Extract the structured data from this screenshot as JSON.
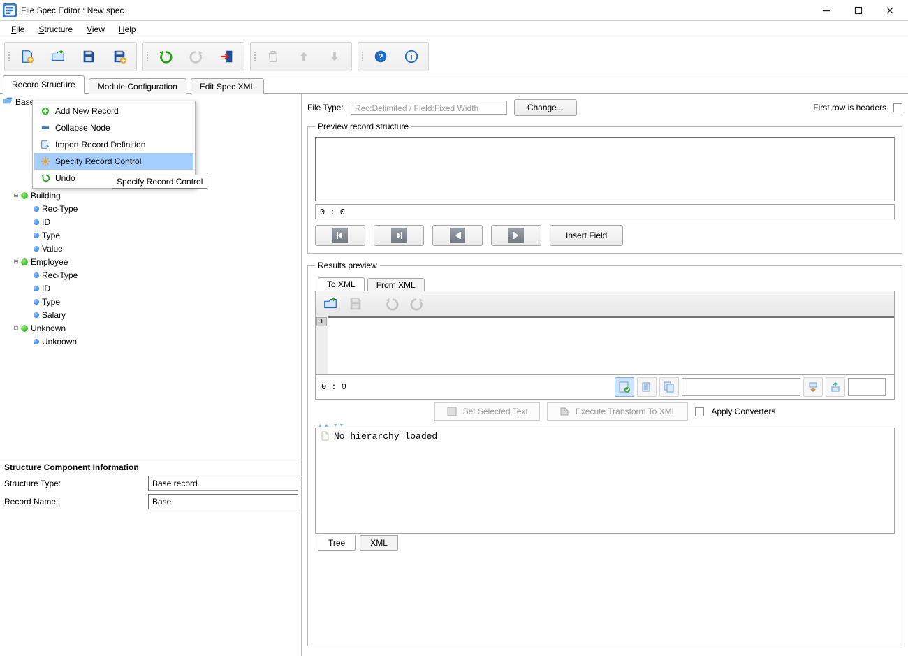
{
  "window": {
    "title": "File Spec Editor : New spec"
  },
  "menu": {
    "file": "File",
    "structure": "Structure",
    "view": "View",
    "help": "Help"
  },
  "main_tabs": {
    "record_structure": "Record Structure",
    "module_config": "Module Configuration",
    "edit_spec_xml": "Edit Spec XML"
  },
  "tree": {
    "root": "Base",
    "building": "Building",
    "building_children": [
      "Rec-Type",
      "ID",
      "Type",
      "Value"
    ],
    "employee": "Employee",
    "employee_children": [
      "Rec-Type",
      "ID",
      "Type",
      "Salary"
    ],
    "unknown": "Unknown",
    "unknown_children": [
      "Unknown"
    ]
  },
  "context_menu": {
    "add": "Add New Record",
    "collapse": "Collapse Node",
    "import": "Import Record Definition",
    "specify": "Specify Record Control",
    "undo": "Undo",
    "tooltip": "Specify Record Control"
  },
  "info": {
    "header": "Structure Component Information",
    "structure_type_label": "Structure Type:",
    "structure_type_value": "Base record",
    "record_name_label": "Record Name:",
    "record_name_value": "Base"
  },
  "right": {
    "file_type_label": "File Type:",
    "file_type_placeholder": "Rec:Delimited / Field:Fixed Width",
    "change": "Change...",
    "first_row": "First row is headers",
    "preview_legend": "Preview record structure",
    "pos_status": "0  :  0",
    "insert_field": "Insert Field",
    "results_legend": "Results preview",
    "tab_to_xml": "To XML",
    "tab_from_xml": "From XML",
    "line1": "1",
    "pos_status2": "0  :  0",
    "set_selected": "Set Selected Text",
    "exec_transform": "Execute Transform To XML",
    "apply_conv": "Apply Converters",
    "hierarchy": "No hierarchy loaded",
    "tree_tab": "Tree",
    "xml_tab": "XML"
  }
}
